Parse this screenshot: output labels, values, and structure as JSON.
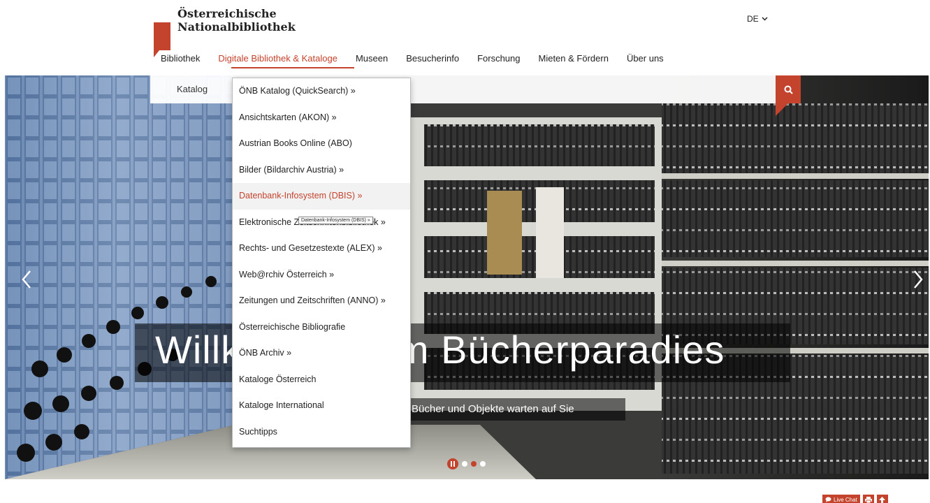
{
  "header": {
    "logo_line1": "Österreichische",
    "logo_line2": "Nationalbibliothek",
    "language": "DE"
  },
  "main_nav": [
    {
      "label": "Bibliothek"
    },
    {
      "label": "Digitale Bibliothek & Kataloge"
    },
    {
      "label": "Museen"
    },
    {
      "label": "Besucherinfo"
    },
    {
      "label": "Forschung"
    },
    {
      "label": "Mieten & Fördern"
    },
    {
      "label": "Über uns"
    }
  ],
  "search": {
    "tab_label": "Katalog",
    "placeholder": ""
  },
  "dropdown": [
    {
      "label": "ÖNB Katalog (QuickSearch) »"
    },
    {
      "label": "Ansichtskarten (AKON) »"
    },
    {
      "label": "Austrian Books Online (ABO)"
    },
    {
      "label": "Bilder (Bildarchiv Austria) »"
    },
    {
      "label": "Datenbank-Infosystem (DBIS) »"
    },
    {
      "label": "Elektronische Zeitschriftenbibliothek »"
    },
    {
      "label": "Rechts- und Gesetzestexte (ALEX) »"
    },
    {
      "label": "Web@rchiv Österreich »"
    },
    {
      "label": "Zeitungen und Zeitschriften (ANNO) »"
    },
    {
      "label": "Österreichische Bibliografie"
    },
    {
      "label": "ÖNB Archiv »"
    },
    {
      "label": "Kataloge Österreich"
    },
    {
      "label": "Kataloge International"
    },
    {
      "label": "Suchtipps"
    }
  ],
  "tooltip": "Datenbank-Infosystem (DBIS) »",
  "hero": {
    "headline": "Willkommen im Bücherparadies",
    "subline": "Bücher und Objekte warten auf Sie"
  },
  "footer_tools": {
    "live_chat": "Live Chat"
  },
  "colors": {
    "accent": "#c4432d"
  }
}
